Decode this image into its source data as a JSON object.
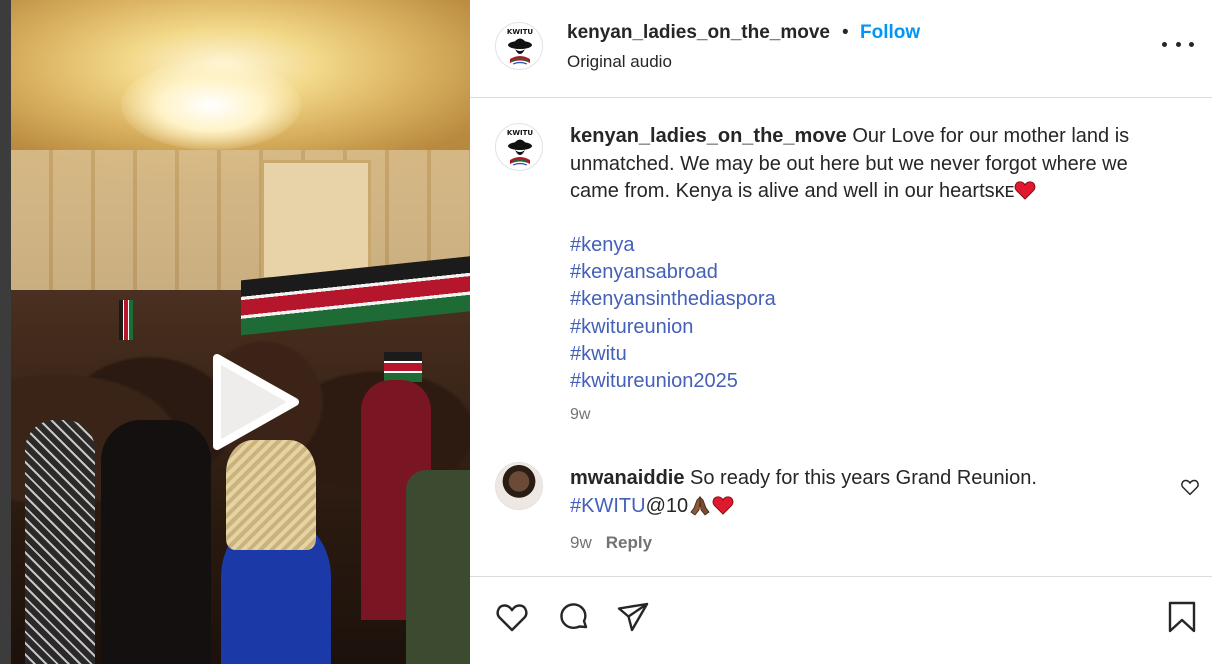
{
  "post": {
    "author": "kenyan_ladies_on_the_move",
    "separator": "•",
    "follow_label": "Follow",
    "audio_label": "Original audio",
    "avatar_logo_text": "KWITU"
  },
  "caption": {
    "author": "kenyan_ladies_on_the_move",
    "text": " Our Love for our mother land is unmatched. We may be out here but we never forgot where we came from. Kenya is alive and well in our hearts",
    "suffix": "ᴋᴇ",
    "hashtags": [
      "#kenya",
      "#kenyansabroad",
      "#kenyansinthediaspora",
      "#kwitureunion",
      "#kwitu",
      "#kwitureunion2025"
    ],
    "time": "9w"
  },
  "comment": {
    "author": "mwanaiddie",
    "text": " So ready for this years Grand Reunion.",
    "tag": "#KWITU",
    "tag_suffix": "@10",
    "time": "9w",
    "reply_label": "Reply"
  },
  "video": {
    "play_icon": "play-icon"
  },
  "actions": {
    "icons": [
      "heart-icon",
      "comment-icon",
      "share-icon",
      "bookmark-icon"
    ]
  },
  "colors": {
    "follow": "#0095f6",
    "hashtag": "#4460b8",
    "heart_emoji": "#e0192e",
    "muted": "#737373"
  }
}
